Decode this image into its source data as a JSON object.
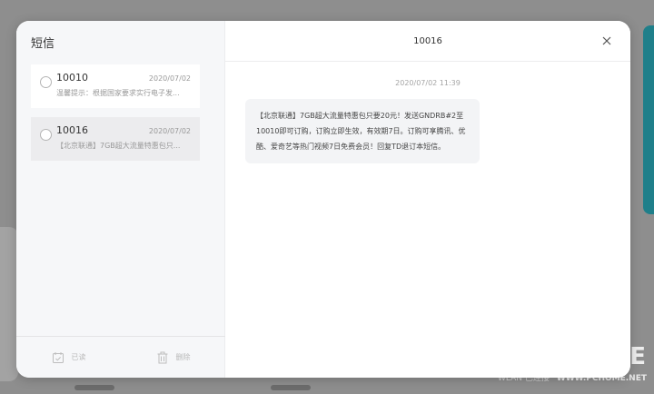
{
  "sms": {
    "title": "短信",
    "messages": [
      {
        "sender": "10010",
        "date": "2020/07/02",
        "preview": "温馨提示：根据国家要求实行电子发..."
      },
      {
        "sender": "10016",
        "date": "2020/07/02",
        "preview": "【北京联通】7GB超大流量特惠包只..."
      }
    ],
    "actions": {
      "read_label": "已读",
      "delete_label": "删除"
    }
  },
  "conversation": {
    "title": "10016",
    "timestamp": "2020/07/02 11:39",
    "body": "【北京联通】7GB超大流量特惠包只要20元！发送GNDRB#2至10010即可订购，订购立即生效，有效期7日。订购可享腾讯、优酷、爱奇艺等热门视频7日免费会员！回复TD退订本短信。"
  },
  "background": {
    "wlan_text": "WLAN 已连接",
    "watermark_big": "E",
    "watermark_url": "WWW.PCHOME.NET"
  },
  "colors": {
    "overlay": "#8e8e8e",
    "teal_accent": "#1f7f8a",
    "selected_row": "#ececee",
    "bubble_bg": "#f3f4f6"
  },
  "icons": {
    "close": "close-icon",
    "read": "read-calendar-icon",
    "delete": "trash-icon"
  }
}
